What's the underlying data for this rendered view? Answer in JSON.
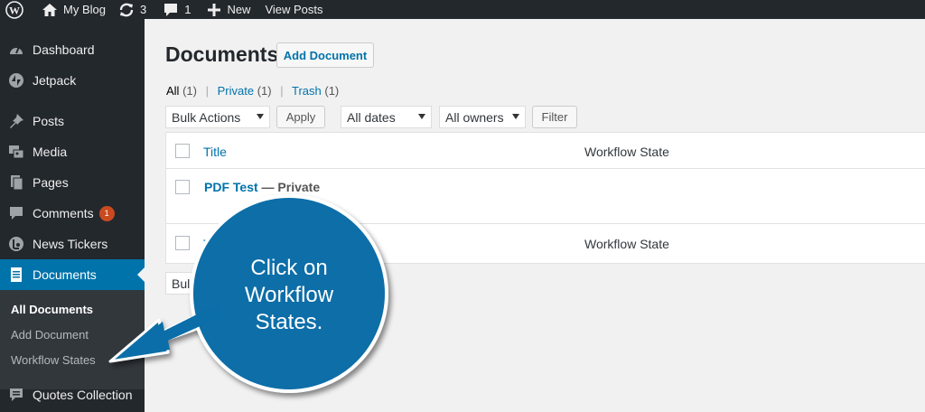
{
  "colors": {
    "adminbar_bg": "#23282d",
    "sidebar_bg": "#23282d",
    "submenu_bg": "#32373c",
    "accent": "#0073aa",
    "badge": "#ca4a1f",
    "callout": "#0b6ea8"
  },
  "adminbar": {
    "items": [
      {
        "icon": "wordpress-logo-icon",
        "label": ""
      },
      {
        "icon": "home-icon",
        "label": "My Blog"
      },
      {
        "icon": "updates-icon",
        "label": "3"
      },
      {
        "icon": "comment-bubble-icon",
        "label": "1"
      },
      {
        "icon": "plus-icon",
        "label": "New"
      },
      {
        "icon": "",
        "label": "View Posts"
      }
    ]
  },
  "sidebar": {
    "items": [
      {
        "icon": "dashboard-icon",
        "label": "Dashboard"
      },
      {
        "icon": "jetpack-icon",
        "label": "Jetpack"
      },
      {
        "icon": "pin-icon",
        "label": "Posts"
      },
      {
        "icon": "media-icon",
        "label": "Media"
      },
      {
        "icon": "pages-icon",
        "label": "Pages"
      },
      {
        "icon": "comments-icon",
        "label": "Comments",
        "badge": "1"
      },
      {
        "icon": "news-tickers-icon",
        "label": "News Tickers"
      },
      {
        "icon": "documents-icon",
        "label": "Documents"
      },
      {
        "icon": "quotes-icon",
        "label": "Quotes Collection"
      }
    ],
    "submenu": [
      "All Documents",
      "Add Document",
      "Workflow States"
    ]
  },
  "main": {
    "title": "Documents",
    "add_button": "Add Document",
    "views": [
      {
        "label": "All",
        "count": "(1)"
      },
      {
        "label": "Private",
        "count": "(1)"
      },
      {
        "label": "Trash",
        "count": "(1)"
      }
    ],
    "bulk_actions": "Bulk Actions",
    "apply": "Apply",
    "all_dates": "All dates",
    "all_owners": "All owners",
    "filter": "Filter",
    "table": {
      "header_title": "Title",
      "header_workflow": "Workflow State",
      "row_title": "PDF Test",
      "row_state": "— Private",
      "footer_title": "Title",
      "footer_workflow": "Workflow State"
    },
    "bulk_actions_bottom": "Bulk Actions"
  },
  "callout": {
    "lines": [
      "Click on",
      "Workflow",
      "States."
    ]
  }
}
